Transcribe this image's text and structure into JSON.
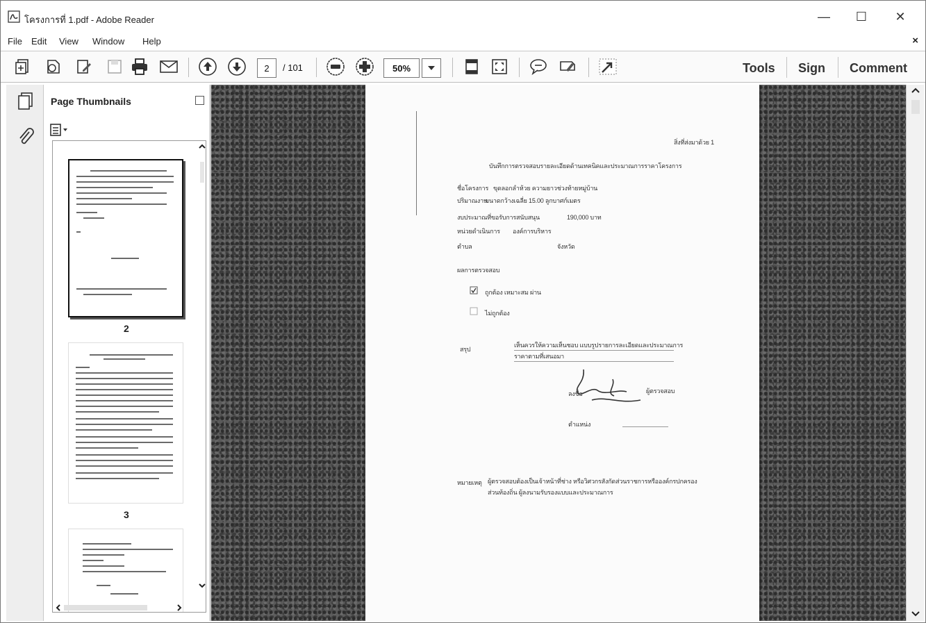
{
  "window": {
    "title": "โครงการที่ 1.pdf - Adobe Reader",
    "minimize_glyph": "—",
    "maximize_glyph": "☐",
    "close_glyph": "✕"
  },
  "menu": {
    "items": [
      "File",
      "Edit",
      "View",
      "Window",
      "Help"
    ],
    "doc_close_glyph": "×"
  },
  "toolbar": {
    "current_page": "2",
    "page_total": "/ 101",
    "zoom": "50%",
    "tools_label": "Tools",
    "sign_label": "Sign",
    "comment_label": "Comment"
  },
  "thumbnails": {
    "panel_title": "Page Thumbnails",
    "pages": [
      {
        "label": "2",
        "selected": true
      },
      {
        "label": "3",
        "selected": false
      }
    ]
  },
  "document": {
    "header_right": "สิ่งที่ส่งมาด้วย 1",
    "title": "บันทึกการตรวจสอบรายละเอียดด้านเทคนิคและประมาณการราคาโครงการ",
    "field_1_label": "ชื่อโครงการ",
    "field_1_value": "ขุดลอกลำห้วย ความยาวช่วงท้ายหมู่บ้าน",
    "field_2_label": "ปริมาณงาน",
    "field_2_value": "ขนาดกว้างเฉลี่ย 15.00 ลูกบาศก์เมตร",
    "field_3_label": "งบประมาณที่ขอรับการสนับสนุน",
    "field_3_value": "190,000 บาท",
    "field_4_label": "หน่วยดำเนินการ",
    "field_4_value": "องค์การบริหาร",
    "field_5_label": "ตำบล",
    "field_5_value": "จังหวัด",
    "section_label": "ผลการตรวจสอบ",
    "check_1": "ถูกต้อง เหมาะสม ผ่าน",
    "check_2": "ไม่ถูกต้อง",
    "opinion_label": "สรุป",
    "opinion_line_1": "เห็นควรให้ความเห็นชอบ แบบรูปรายการละเอียดและประมาณการ",
    "opinion_line_2": "ราคาตามที่เสนอมา",
    "signer_label": "ลงชื่อ",
    "signer_title": "ผู้ตรวจสอบ",
    "position_label": "ตำแหน่ง",
    "note_label": "หมายเหตุ",
    "note_line_1": "ผู้ตรวจสอบต้องเป็นเจ้าหน้าที่ช่าง หรือวิศวกรสังกัดส่วนราชการหรือองค์กรปกครอง",
    "note_line_2": "ส่วนท้องถิ่น ผู้ลงนามรับรองแบบและประมาณการ"
  },
  "icons": {
    "app": "adobe-reader-icon",
    "page_thumbnails": "page-thumbnails-icon",
    "attachments": "paperclip-icon",
    "options": "thumbnail-options-icon"
  }
}
